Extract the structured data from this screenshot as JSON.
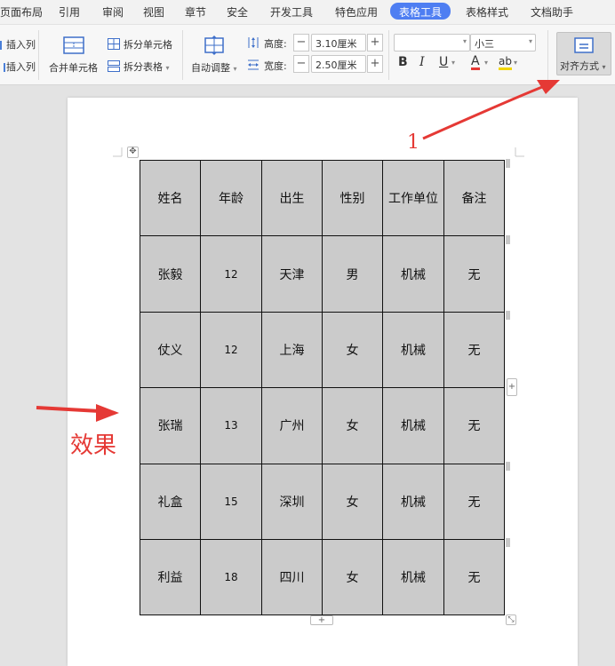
{
  "menu": {
    "items": [
      "页面布局",
      "引用",
      "审阅",
      "视图",
      "章节",
      "安全",
      "开发工具",
      "特色应用",
      "表格工具",
      "表格样式",
      "文档助手"
    ],
    "active": "表格工具"
  },
  "ribbon": {
    "insert_col_left": "插入列",
    "insert_col_right": "插入列",
    "merge_cells": "合并单元格",
    "split_cells": "拆分单元格",
    "split_table": "拆分表格",
    "auto_fit": "自动调整",
    "height_label": "高度:",
    "height_value": "3.10厘米",
    "width_label": "宽度:",
    "width_value": "2.50厘米",
    "font_name_value": "",
    "font_size_value": "小三",
    "bold": "B",
    "italic": "I",
    "underline": "U",
    "font_color": "A",
    "highlight": "ab",
    "align_label": "对齐方式",
    "minus": "−",
    "plus": "+"
  },
  "table": {
    "rows": [
      [
        "姓名",
        "年龄",
        "出生",
        "性别",
        "工作单位",
        "备注"
      ],
      [
        "张毅",
        "12",
        "天津",
        "男",
        "机械",
        "无"
      ],
      [
        "仗义",
        "12",
        "上海",
        "女",
        "机械",
        "无"
      ],
      [
        "张瑞",
        "13",
        "广州",
        "女",
        "机械",
        "无"
      ],
      [
        "礼盒",
        "15",
        "深圳",
        "女",
        "机械",
        "无"
      ],
      [
        "利益",
        "18",
        "四川",
        "女",
        "机械",
        "无"
      ]
    ]
  },
  "annotations": {
    "step_number": "1",
    "effect_label": "效果",
    "color": "#e53935"
  },
  "colors": {
    "accent": "#4e7ef2",
    "table_fill": "#cbcbcb"
  },
  "icons": [
    "move-table-icon",
    "add-row-icon",
    "add-col-icon",
    "resize-table-icon",
    "align-icon"
  ]
}
